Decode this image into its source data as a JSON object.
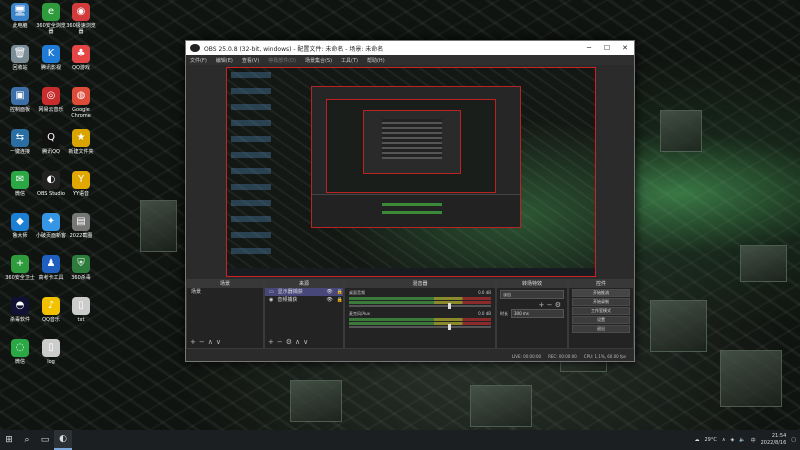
{
  "desktop": {
    "icons": [
      {
        "label": "此电脑",
        "glyph": "🖥",
        "color": "#3a82c9"
      },
      {
        "label": "360安全浏览器",
        "glyph": "e",
        "color": "#2e9c3c"
      },
      {
        "label": "360极速浏览器",
        "glyph": "◉",
        "color": "#d23b3b"
      },
      {
        "label": "回收站",
        "glyph": "🗑",
        "color": "#7a8c96"
      },
      {
        "label": "腾讯影视",
        "glyph": "K",
        "color": "#1f7bd6"
      },
      {
        "label": "QQ游戏",
        "glyph": "♣",
        "color": "#e64545"
      },
      {
        "label": "控制面板",
        "glyph": "▣",
        "color": "#3c6fa8"
      },
      {
        "label": "网易云音乐",
        "glyph": "◎",
        "color": "#c82c2c"
      },
      {
        "label": "Google Chrome",
        "glyph": "◍",
        "color": "#dd4b39"
      },
      {
        "label": "一键连接",
        "glyph": "⇆",
        "color": "#2a6ea3"
      },
      {
        "label": "腾讯QQ",
        "glyph": "Q",
        "color": "#111"
      },
      {
        "label": "新建文件夹",
        "glyph": "★",
        "color": "#d9a400"
      },
      {
        "label": "微信",
        "glyph": "✉",
        "color": "#2aa845"
      },
      {
        "label": "OBS Studio",
        "glyph": "◐",
        "color": "#222"
      },
      {
        "label": "YY语音",
        "glyph": "Y",
        "color": "#e0a800"
      },
      {
        "label": "鲁大师",
        "glyph": "◆",
        "color": "#1d7fd3"
      },
      {
        "label": "小破页面新客",
        "glyph": "✦",
        "color": "#3596e6"
      },
      {
        "label": "2022截图",
        "glyph": "▤",
        "color": "#777"
      },
      {
        "label": "360安全卫士",
        "glyph": "+",
        "color": "#2e9c3c"
      },
      {
        "label": "高考卡工具",
        "glyph": "♟",
        "color": "#1f5fbf"
      },
      {
        "label": "360杀毒",
        "glyph": "⛨",
        "color": "#2e7c3c"
      },
      {
        "label": "杀毒软件",
        "glyph": "◓",
        "color": "#113"
      },
      {
        "label": "QQ音乐",
        "glyph": "♪",
        "color": "#f2c200"
      },
      {
        "label": "txt",
        "glyph": "▯",
        "color": "#ccc"
      },
      {
        "label": "微信",
        "glyph": "◌",
        "color": "#2aa845"
      },
      {
        "label": "log",
        "glyph": "▯",
        "color": "#ccc"
      }
    ]
  },
  "obs": {
    "title": "OBS 25.0.8 (32-bit, windows) - 配置文件: 未命名 - 场景: 未命名",
    "menu": [
      "文件(F)",
      "编辑(E)",
      "查看(V)",
      "停靠部件(D)",
      "场景集合(S)",
      "工具(T)",
      "帮助(H)"
    ],
    "docks": {
      "scenes": {
        "title": "场景",
        "items": [
          "场景"
        ]
      },
      "sources": {
        "title": "来源",
        "items": [
          "显示器捕获",
          "音频捕获"
        ]
      },
      "mixer": {
        "title": "混音器",
        "channels": [
          {
            "name": "桌面音频",
            "db": "0.0 dB"
          },
          {
            "name": "麦克风/Aux",
            "db": "0.0 dB"
          }
        ]
      },
      "transitions": {
        "title": "转场特效",
        "type": "淡出",
        "duration_label": "时长",
        "duration": "300 ms"
      },
      "controls": {
        "title": "控件",
        "buttons": [
          "开始推流",
          "开始录制",
          "工作室模式",
          "设置",
          "退出"
        ]
      }
    },
    "status": {
      "live": "LIVE: 00:00:00",
      "rec": "REC: 00:00:00",
      "cpu": "CPU: 1.1%, 60.00 fps"
    }
  },
  "taskbar": {
    "weather": "29°C",
    "time": "21:54",
    "date": "2022/8/16"
  }
}
